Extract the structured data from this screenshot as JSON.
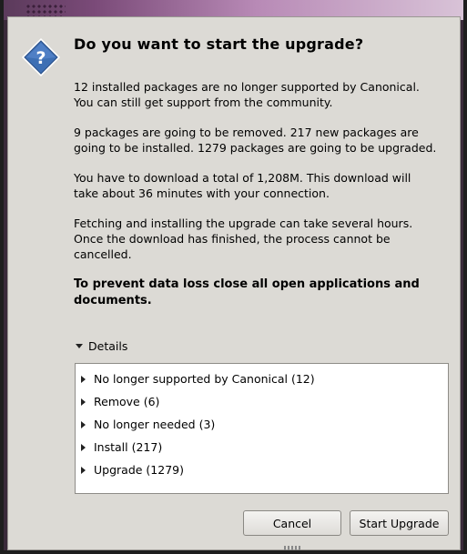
{
  "dialog": {
    "title": "Do you want to start the upgrade?",
    "paragraphs": [
      "12 installed packages are no longer supported by Canonical. You can still get support from the community.",
      "9 packages are going to be removed. 217 new packages are going to be installed. 1279 packages are going to be upgraded.",
      "You have to download a total of 1,208M. This download will take about 36 minutes with your connection.",
      "Fetching and installing the upgrade can take several hours. Once the download has finished, the process cannot be cancelled."
    ],
    "warning": "To prevent data loss close all open applications and documents.",
    "details_label": "Details",
    "details_items": [
      "No longer supported by Canonical (12)",
      "Remove (6)",
      "No longer needed (3)",
      "Install (217)",
      "Upgrade (1279)"
    ],
    "cancel_label": "Cancel",
    "start_label": "Start Upgrade",
    "icon": "question-icon",
    "icon_color": "#3d6fb4"
  }
}
